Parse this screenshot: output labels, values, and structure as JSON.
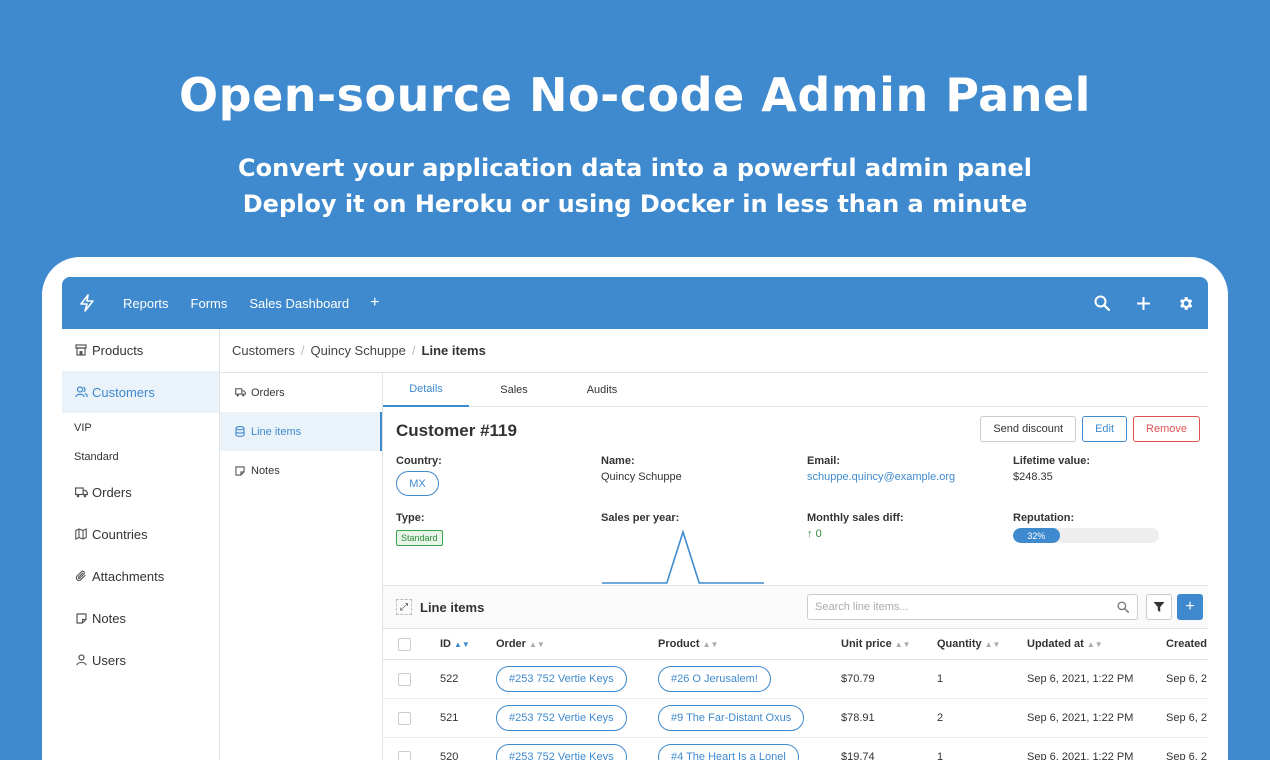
{
  "hero": {
    "title": "Open-source No-code Admin Panel",
    "subtitle_line1": "Convert your application data into a powerful admin panel",
    "subtitle_line2": "Deploy it on Heroku or using Docker in less than a minute"
  },
  "colors": {
    "brand": "#3f8ace",
    "danger": "#e05252",
    "success": "#2e8c3c"
  },
  "navbar": {
    "logo_icon": "bolt-icon",
    "links": [
      "Reports",
      "Forms",
      "Sales Dashboard"
    ],
    "add_label": "+",
    "right_icons": [
      "search-icon",
      "plus-icon",
      "gear-icon"
    ]
  },
  "sidebar": {
    "items": [
      {
        "label": "Products",
        "icon": "store-icon"
      },
      {
        "label": "Customers",
        "icon": "users-icon"
      },
      {
        "label": "VIP"
      },
      {
        "label": "Standard"
      },
      {
        "label": "Orders",
        "icon": "truck-icon"
      },
      {
        "label": "Countries",
        "icon": "map-icon"
      },
      {
        "label": "Attachments",
        "icon": "paperclip-icon"
      },
      {
        "label": "Notes",
        "icon": "note-icon"
      },
      {
        "label": "Users",
        "icon": "user-icon"
      }
    ]
  },
  "breadcrumb": [
    "Customers",
    "Quincy Schuppe",
    "Line items"
  ],
  "subnav": {
    "items": [
      {
        "label": "Orders",
        "icon": "truck-icon"
      },
      {
        "label": "Line items",
        "icon": "database-icon"
      },
      {
        "label": "Notes",
        "icon": "note-icon"
      }
    ]
  },
  "tabs": [
    "Details",
    "Sales",
    "Audits"
  ],
  "record": {
    "title": "Customer #119",
    "buttons": {
      "send_discount": "Send discount",
      "edit": "Edit",
      "remove": "Remove"
    },
    "fields": {
      "country": {
        "label": "Country:",
        "value": "MX"
      },
      "name": {
        "label": "Name:",
        "value": "Quincy Schuppe"
      },
      "email": {
        "label": "Email:",
        "value": "schuppe.quincy@example.org"
      },
      "lifetime": {
        "label": "Lifetime value:",
        "value": "$248.35"
      },
      "type": {
        "label": "Type:",
        "value": "Standard"
      },
      "sales_per_year": {
        "label": "Sales per year:"
      },
      "monthly_diff": {
        "label": "Monthly sales diff:",
        "arrow": "↑",
        "value": "0"
      },
      "reputation": {
        "label": "Reputation:",
        "value": "32%",
        "percent": 32
      }
    }
  },
  "chart_data": {
    "type": "line",
    "values": [
      0,
      0,
      0,
      0,
      0,
      1,
      0,
      0,
      0,
      0,
      0
    ]
  },
  "line_items": {
    "title": "Line items",
    "search_placeholder": "Search line items...",
    "columns": [
      "ID",
      "Order",
      "Product",
      "Unit price",
      "Quantity",
      "Updated at",
      "Created"
    ],
    "rows": [
      {
        "id": "522",
        "order": "#253 752 Vertie Keys",
        "product": "#26 O Jerusalem!",
        "price": "$70.79",
        "qty": "1",
        "updated": "Sep 6, 2021, 1:22 PM",
        "created": "Sep 6, 2"
      },
      {
        "id": "521",
        "order": "#253 752 Vertie Keys",
        "product": "#9 The Far-Distant Oxus",
        "price": "$78.91",
        "qty": "2",
        "updated": "Sep 6, 2021, 1:22 PM",
        "created": "Sep 6, 2"
      },
      {
        "id": "520",
        "order": "#253 752 Vertie Keys",
        "product": "#4 The Heart Is a Lonel",
        "price": "$19.74",
        "qty": "1",
        "updated": "Sep 6, 2021, 1:22 PM",
        "created": "Sep 6, 2"
      }
    ]
  }
}
